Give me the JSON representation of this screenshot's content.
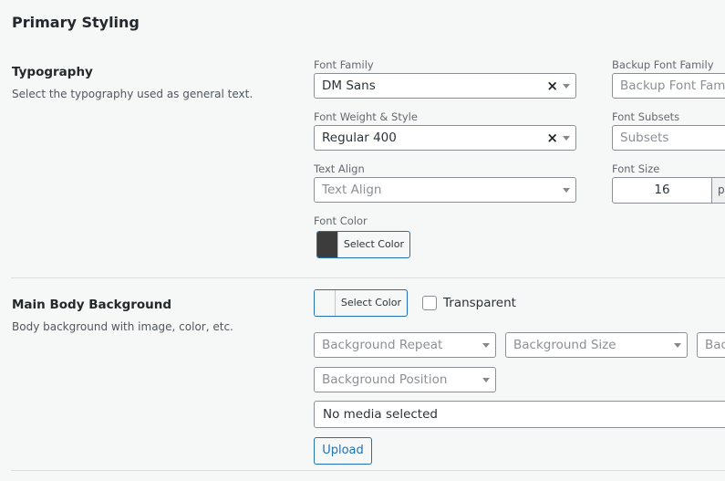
{
  "page_title": "Primary Styling",
  "typography": {
    "title": "Typography",
    "description": "Select the typography used as general text.",
    "font_family": {
      "label": "Font Family",
      "value": "DM Sans"
    },
    "backup_font_family": {
      "label": "Backup Font Family",
      "placeholder": "Backup Font Family"
    },
    "font_weight_style": {
      "label": "Font Weight & Style",
      "value": "Regular 400"
    },
    "font_subsets": {
      "label": "Font Subsets",
      "placeholder": "Subsets"
    },
    "text_align": {
      "label": "Text Align",
      "placeholder": "Text Align"
    },
    "font_size": {
      "label": "Font Size",
      "value": "16",
      "unit": "px"
    },
    "font_color": {
      "label": "Font Color",
      "button_label": "Select Color",
      "color": "#3c3c3c"
    }
  },
  "main_body_background": {
    "title": "Main Body Background",
    "description": "Body background with image, color, etc.",
    "color_button_label": "Select Color",
    "color": "#ffffff",
    "transparent_label": "Transparent",
    "background_repeat": {
      "placeholder": "Background Repeat"
    },
    "background_size": {
      "placeholder": "Background Size"
    },
    "background_attachment": {
      "placeholder": "Bac"
    },
    "background_position": {
      "placeholder": "Background Position"
    },
    "media": {
      "value": "No media selected"
    },
    "upload_label": "Upload"
  }
}
